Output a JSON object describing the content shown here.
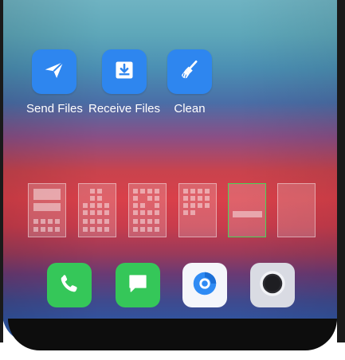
{
  "apps": [
    {
      "label": "Send Files",
      "icon": "paper-plane-icon"
    },
    {
      "label": "Receive Files",
      "icon": "download-tray-icon"
    },
    {
      "label": "Clean",
      "icon": "broom-icon"
    }
  ],
  "screens": {
    "count": 6,
    "active_index": 4
  },
  "dock": [
    {
      "icon": "phone-icon",
      "color": "#35c759"
    },
    {
      "icon": "message-icon",
      "color": "#35c759"
    },
    {
      "icon": "browser-icon",
      "color": "#2f8bf4"
    },
    {
      "icon": "camera-icon",
      "color": "#d9dbe3"
    }
  ],
  "colors": {
    "app_tile": "#2e86ef",
    "active_screen_border": "#4bd35a"
  }
}
